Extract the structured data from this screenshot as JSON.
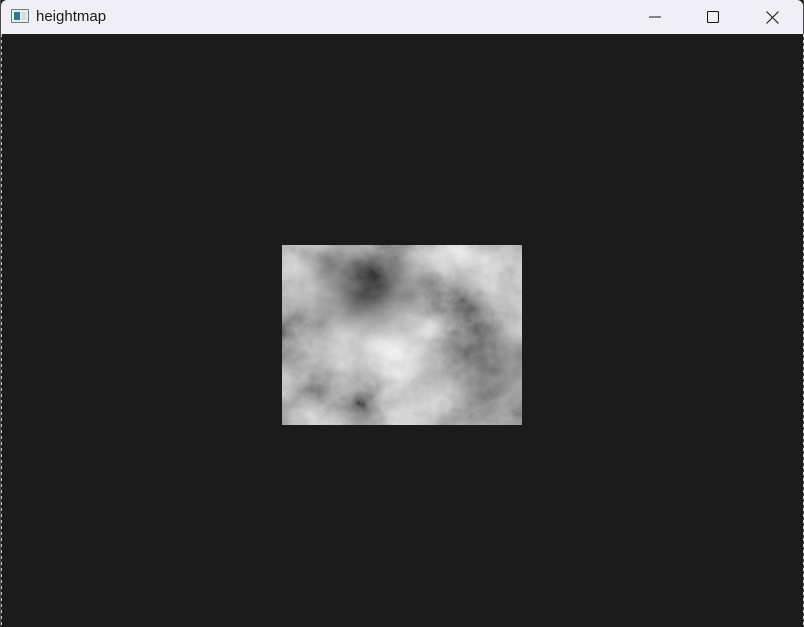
{
  "window": {
    "title": "heightmap",
    "controls": {
      "minimize_icon": "minimize-icon",
      "maximize_icon": "maximize-icon",
      "close_icon": "close-icon"
    }
  },
  "canvas": {
    "background": "#1b1b1b",
    "image_icon": "heightmap-noise-texture"
  },
  "colors": {
    "titlebar": "#f0eff5",
    "client_background": "#1b1b1b"
  }
}
